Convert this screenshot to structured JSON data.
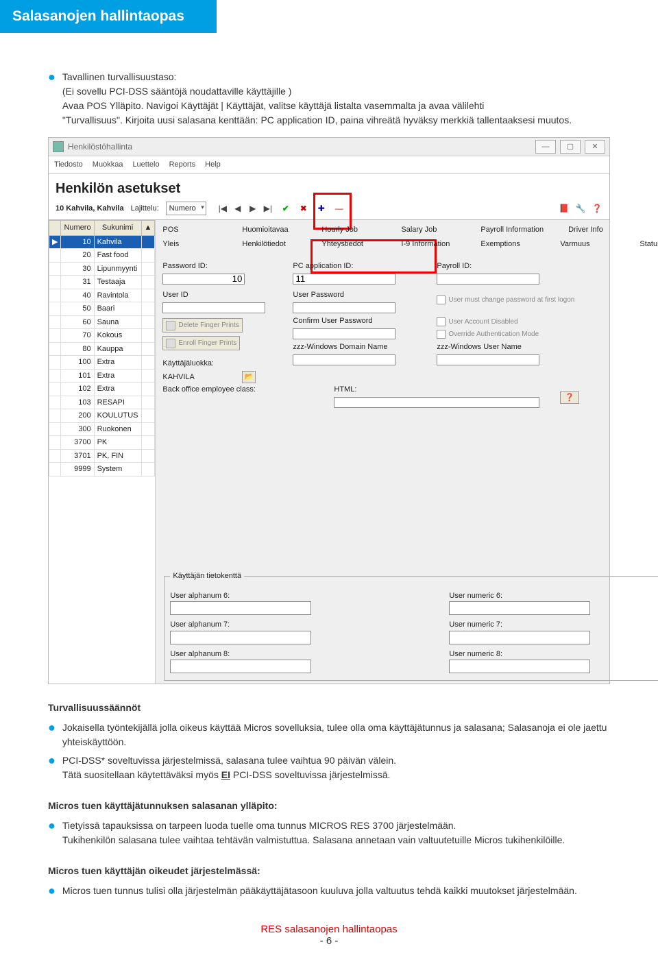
{
  "header": {
    "title": "Salasanojen hallintaopas"
  },
  "intro": {
    "bullet_heading": "Tavallinen turvallisuustaso:",
    "line1": "(Ei sovellu PCI-DSS sääntöjä noudattaville käyttäjille )",
    "line2_a": "Avaa POS Ylläpito. Navigoi Käyttäjät | Käyttäjät, valitse käyttäjä listalta vasemmalta ja avaa välilehti",
    "line2_b": "\"Turvallisuus\". Kirjoita uusi salasana kenttään: PC application ID, paina vihreätä hyväksy merkkiä tallentaaksesi muutos."
  },
  "screenshot": {
    "title": "Henkilöstöhallinta",
    "menus": [
      "Tiedosto",
      "Muokkaa",
      "Luettelo",
      "Reports",
      "Help"
    ],
    "heading": "Henkilön asetukset",
    "current_row": "10  Kahvila, Kahvila",
    "sort_label": "Lajittelu:",
    "sort_value": "Numero",
    "left_table": {
      "headers": [
        "Numero",
        "Sukunimi"
      ],
      "rows": [
        {
          "n": "10",
          "name": "Kahvila",
          "sel": true
        },
        {
          "n": "20",
          "name": "Fast food"
        },
        {
          "n": "30",
          "name": "Lipunmyynti"
        },
        {
          "n": "31",
          "name": "Testaaja"
        },
        {
          "n": "40",
          "name": "Ravintola"
        },
        {
          "n": "50",
          "name": "Baari"
        },
        {
          "n": "60",
          "name": "Sauna"
        },
        {
          "n": "70",
          "name": "Kokous"
        },
        {
          "n": "80",
          "name": "Kauppa"
        },
        {
          "n": "100",
          "name": "Extra"
        },
        {
          "n": "101",
          "name": "Extra"
        },
        {
          "n": "102",
          "name": "Extra"
        },
        {
          "n": "103",
          "name": "RESAPI"
        },
        {
          "n": "200",
          "name": "KOULUTUS"
        },
        {
          "n": "300",
          "name": "Ruokonen"
        },
        {
          "n": "3700",
          "name": "PK"
        },
        {
          "n": "3701",
          "name": "PK, FIN"
        },
        {
          "n": "9999",
          "name": "System"
        }
      ]
    },
    "tabs_row1": [
      "POS",
      "Huomioitavaa",
      "Hourly Job",
      "Salary Job",
      "Payroll Information",
      "Driver Info"
    ],
    "tabs_row2": [
      "Yleis",
      "Henkilötiedot",
      "Yhteystiedot",
      "I-9 Information",
      "Exemptions",
      "Varmuus",
      "Status"
    ],
    "labels": {
      "password_id": "Password ID:",
      "password_id_val": "10",
      "pc_app_id": "PC application ID:",
      "pc_app_id_val": "11",
      "payroll_id": "Payroll ID:",
      "user_id": "User ID",
      "user_pwd": "User Password",
      "confirm_pwd": "Confirm User Password",
      "delete_fp": "Delete Finger Prints",
      "enroll_fp": "Enroll Finger Prints",
      "domain": "zzz-Windows Domain Name",
      "win_user": "zzz-Windows User Name",
      "user_class": "Käyttäjäluokka:",
      "user_class_val": "KAHVILA",
      "bo_class": "Back office employee class:",
      "html": "HTML:",
      "cb1": "User must change password at first logon",
      "cb2": "User Account Disabled",
      "cb3": "Override Authentication Mode",
      "group_title": "Käyttäjän tietokenttä",
      "ua6": "User alphanum 6:",
      "ua7": "User alphanum 7:",
      "ua8": "User alphanum 8:",
      "un6": "User numeric 6:",
      "un7": "User numeric 7:",
      "un8": "User numeric 8:"
    }
  },
  "rules": {
    "heading": "Turvallisuussäännöt",
    "b1": "Jokaisella työntekijällä jolla oikeus käyttää Micros sovelluksia, tulee olla oma käyttäjätunnus ja salasana; Salasanoja ei ole jaettu yhteiskäyttöön.",
    "b2a": "PCI-DSS* soveltuvissa järjestelmissä, salasana tulee vaihtua 90 päivän välein.",
    "b2b_pre": "Tätä suositellaan käytettäväksi myös ",
    "b2b_em": "EI",
    "b2b_post": " PCI-DSS soveltuvissa järjestelmissä.",
    "h2": "Micros tuen käyttäjätunnuksen salasanan ylläpito:",
    "b3a": "Tietyissä tapauksissa on tarpeen luoda tuelle oma tunnus MICROS RES 3700 järjestelmään.",
    "b3b": "Tukihenkilön salasana tulee vaihtaa tehtävän valmistuttua. Salasana annetaan vain valtuutetuille Micros tukihenkilöille.",
    "h3": "Micros tuen käyttäjän oikeudet järjestelmässä:",
    "b4": "Micros tuen tunnus tulisi olla järjestelmän pääkäyttäjätasoon kuuluva jolla valtuutus tehdä kaikki muutokset järjestelmään."
  },
  "footer": {
    "title": "RES salasanojen hallintaopas",
    "page": "- 6 -"
  }
}
